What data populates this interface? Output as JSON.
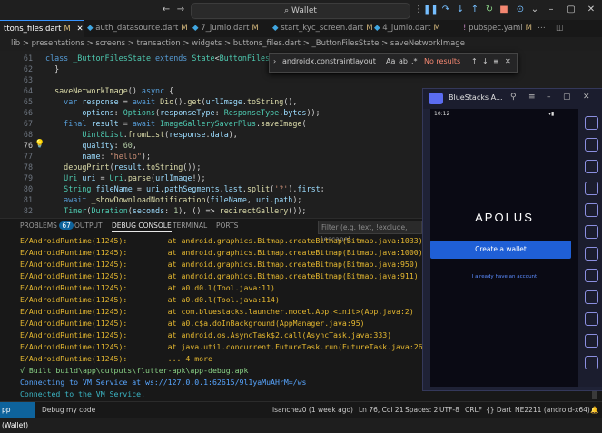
{
  "titlebar": {
    "search_text": "Wallet",
    "icons": [
      "back-arrow-icon",
      "forward-arrow-icon",
      "pause-icon",
      "step-over-icon",
      "step-into-icon",
      "step-out-icon",
      "restart-icon",
      "stop-icon",
      "inspect-icon",
      "chevron-down-icon"
    ]
  },
  "tabs": [
    {
      "label": "ttons_files.dart",
      "badge": "M",
      "active": true
    },
    {
      "label": "auth_datasource.dart",
      "badge": "M"
    },
    {
      "label": "7_jumio.dart",
      "badge": "M"
    },
    {
      "label": "start_kyc_screen.dart",
      "badge": "M"
    },
    {
      "label": "4_jumio.dart",
      "badge": "M"
    },
    {
      "label": "pubspec.yaml",
      "badge": "M"
    }
  ],
  "breadcrumb": "lib > presentations > screens > transaction > widgets > buttons_files.dart > _ButtonFilesState > saveNetworkImage",
  "find_widget": {
    "query": "androidx.constraintlayout",
    "option": "Aa",
    "result": "No results"
  },
  "editor": {
    "current_line": 76,
    "lines": [
      {
        "n": "61",
        "text": "class _ButtonFilesState extends State<ButtonFiles> {"
      },
      {
        "n": "62",
        "text": "  }"
      },
      {
        "n": "63",
        "text": ""
      },
      {
        "n": "64",
        "text": "  saveNetworkImage() async {"
      },
      {
        "n": "65",
        "text": "    var response = await Dio().get(urlImage.toString(),"
      },
      {
        "n": "66",
        "text": "        options: Options(responseType: ResponseType.bytes));"
      },
      {
        "n": "67",
        "text": "    final result = await ImageGallerySaverPlus.saveImage("
      },
      {
        "n": "68",
        "text": "        Uint8List.fromList(response.data),"
      },
      {
        "n": "76",
        "text": "        quality: 60,"
      },
      {
        "n": "77",
        "text": "        name: \"hello\");"
      },
      {
        "n": "78",
        "text": "    debugPrint(result.toString());"
      },
      {
        "n": "79",
        "text": "    Uri uri = Uri.parse(urlImage!);"
      },
      {
        "n": "80",
        "text": "    String fileName = uri.pathSegments.last.split('?').first;"
      },
      {
        "n": "81",
        "text": "    await _showDownloadNotification(fileName, uri.path);"
      },
      {
        "n": "82",
        "text": "    Timer(Duration(seconds: 1), () => redirectGallery());"
      }
    ]
  },
  "panel": {
    "tabs": [
      {
        "label": "PROBLEMS",
        "badge": "67"
      },
      {
        "label": "OUTPUT"
      },
      {
        "label": "DEBUG CONSOLE",
        "active": true
      },
      {
        "label": "TERMINAL"
      },
      {
        "label": "PORTS"
      }
    ],
    "filter_placeholder": "Filter (e.g. text, !exclude, \\escape)",
    "console_lines": [
      {
        "text": "E/AndroidRuntime(11245):         at android.graphics.Bitmap.createBitmap(Bitmap.java:1033)",
        "kind": "err"
      },
      {
        "text": "E/AndroidRuntime(11245):         at android.graphics.Bitmap.createBitmap(Bitmap.java:1000)",
        "kind": "err"
      },
      {
        "text": "E/AndroidRuntime(11245):         at android.graphics.Bitmap.createBitmap(Bitmap.java:950)",
        "kind": "err"
      },
      {
        "text": "E/AndroidRuntime(11245):         at android.graphics.Bitmap.createBitmap(Bitmap.java:911)",
        "kind": "err"
      },
      {
        "text": "E/AndroidRuntime(11245):         at a0.d0.l(Tool.java:11)",
        "kind": "err"
      },
      {
        "text": "E/AndroidRuntime(11245):         at a0.d0.l(Tool.java:114)",
        "kind": "err"
      },
      {
        "text": "E/AndroidRuntime(11245):         at com.bluestacks.launcher.model.App.<init>(App.java:2)",
        "kind": "err"
      },
      {
        "text": "E/AndroidRuntime(11245):         at a0.c$a.doInBackground(AppManager.java:95)",
        "kind": "err"
      },
      {
        "text": "E/AndroidRuntime(11245):         at android.os.AsyncTask$2.call(AsyncTask.java:333)",
        "kind": "err"
      },
      {
        "text": "E/AndroidRuntime(11245):         at java.util.concurrent.FutureTask.run(FutureTask.java:266)",
        "kind": "err"
      },
      {
        "text": "E/AndroidRuntime(11245):         ... 4 more",
        "kind": "err"
      },
      {
        "text": "√ Built build\\app\\outputs\\flutter-apk\\app-debug.apk",
        "kind": "grn"
      },
      {
        "text": "Connecting to VM Service at ws://127.0.0.1:62615/9l1yaMuAHrM=/ws",
        "kind": "blu"
      },
      {
        "text": "Connected to the VM Service.",
        "kind": "cyan"
      }
    ]
  },
  "statusbar": {
    "left": "pp (Wallet)",
    "debug": "Debug my code",
    "author": "isanchez0 (1 week ago)",
    "position": "Ln 76, Col 21",
    "spaces": "Spaces: 2",
    "encoding": "UTF-8",
    "eol": "CRLF",
    "language": "{} Dart",
    "device": "NE2211 (android-x64)"
  },
  "bluestacks": {
    "title": "BlueStacks A...",
    "clock": "10:12",
    "logo": "APOLUS",
    "create_button": "Create a wallet",
    "account_link": "I already have an account"
  }
}
